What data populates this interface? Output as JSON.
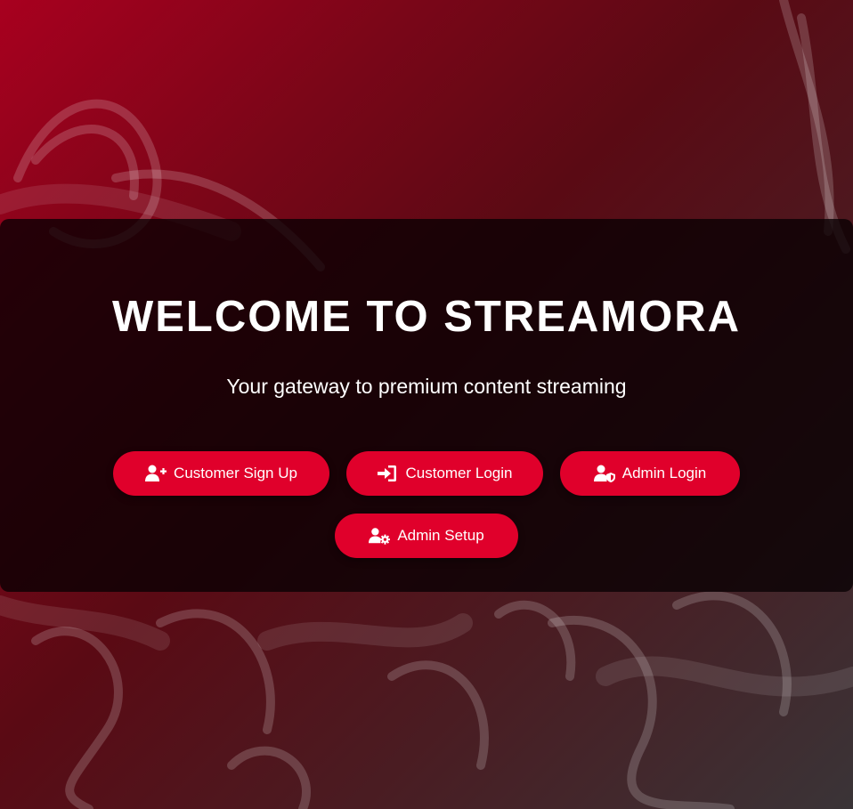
{
  "hero": {
    "title": "WELCOME TO STREAMORA",
    "subtitle": "Your gateway to premium content streaming"
  },
  "buttons": {
    "signup": {
      "label": "Customer Sign Up",
      "icon": "user-plus-icon"
    },
    "login": {
      "label": "Customer Login",
      "icon": "sign-in-icon"
    },
    "admin_login": {
      "label": "Admin Login",
      "icon": "user-shield-icon"
    },
    "admin_setup": {
      "label": "Admin Setup",
      "icon": "user-gear-icon"
    }
  },
  "colors": {
    "accent": "#e0002b",
    "background_top": "#a8001f",
    "background_bottom": "#3a3437",
    "panel": "rgba(8,0,2,0.78)",
    "text": "#ffffff"
  }
}
